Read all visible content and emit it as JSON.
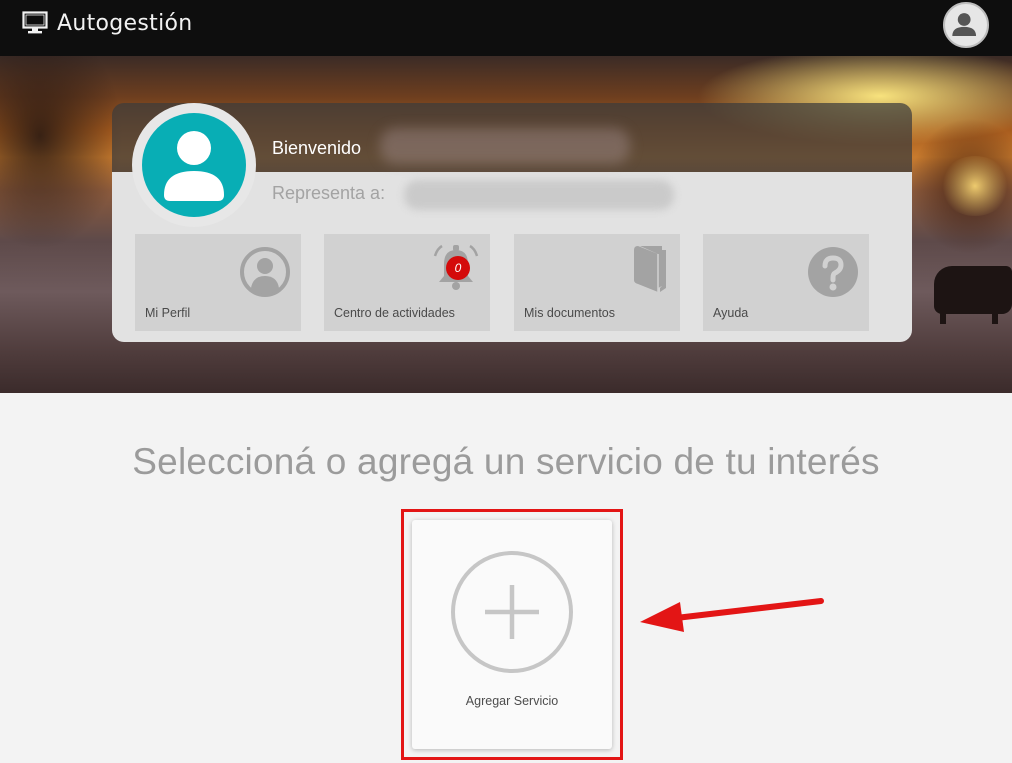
{
  "header": {
    "title": "Autogestión",
    "brand_icon": "monitor-icon",
    "user_icon": "user-avatar-icon"
  },
  "welcome_card": {
    "greeting": "Bienvenido",
    "represents_label": "Representa a:",
    "tiles": [
      {
        "label": "Mi Perfil",
        "icon": "profile-icon"
      },
      {
        "label": "Centro de actividades",
        "icon": "bell-icon",
        "badge": "0"
      },
      {
        "label": "Mis documentos",
        "icon": "book-icon"
      },
      {
        "label": "Ayuda",
        "icon": "help-icon"
      }
    ]
  },
  "services": {
    "title": "Seleccioná o agregá un servicio de tu interés",
    "add_label": "Agregar Servicio",
    "add_icon": "plus-circle-icon"
  },
  "colors": {
    "accent_teal": "#08aeb5",
    "badge_red": "#d40b0b",
    "annotation_red": "#e31515",
    "topbar": "#0e0e0e"
  }
}
